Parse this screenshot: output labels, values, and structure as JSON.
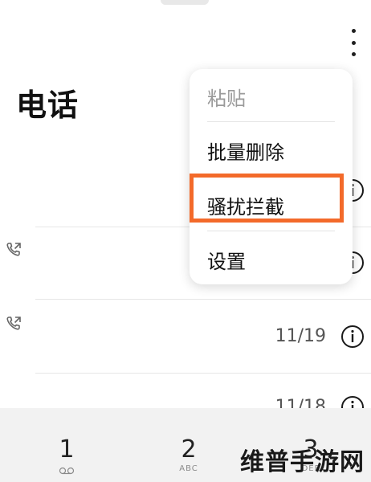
{
  "header": {
    "title": "电话"
  },
  "menu": {
    "items": [
      {
        "label": "粘贴",
        "enabled": false
      },
      {
        "label": "批量删除",
        "enabled": true
      },
      {
        "label": "骚扰拦截",
        "enabled": true,
        "highlighted": true
      },
      {
        "label": "设置",
        "enabled": true
      }
    ],
    "highlight_color": "#f36a2a"
  },
  "call_log": [
    {
      "icon": "outgoing-call-icon",
      "date": ""
    },
    {
      "icon": "outgoing-call-icon",
      "date": "11/19"
    },
    {
      "icon": "outgoing-call-icon",
      "date": "11/18"
    }
  ],
  "dialpad": {
    "keys": [
      {
        "digit": "1",
        "sub": "voicemail-icon"
      },
      {
        "digit": "2",
        "sub": "ABC"
      },
      {
        "digit": "3",
        "sub": "DEF"
      }
    ]
  },
  "watermark": "维普手游网"
}
